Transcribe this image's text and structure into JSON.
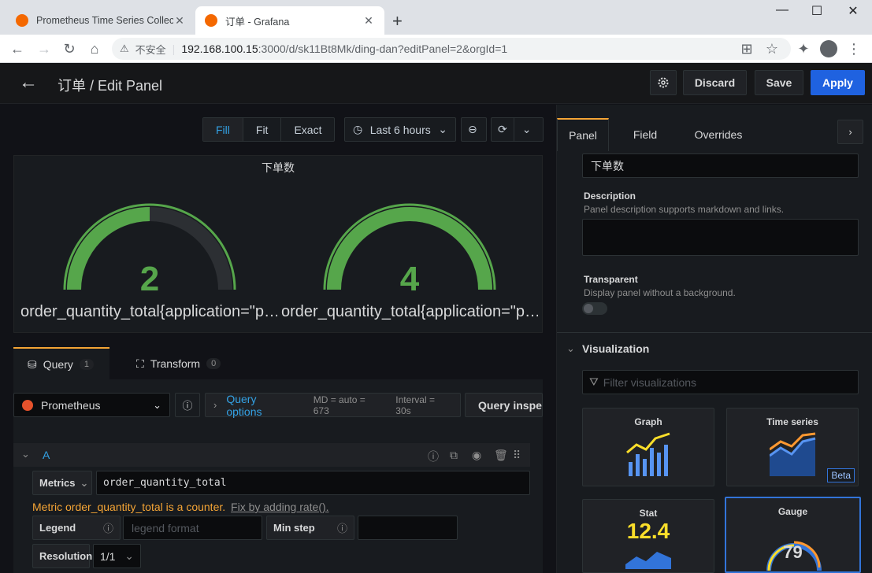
{
  "browser": {
    "tabs": [
      {
        "title": "Prometheus Time Series Collec",
        "active": false
      },
      {
        "title": "订单 - Grafana",
        "active": true
      }
    ],
    "new_tab": "+",
    "win_min": "—",
    "win_max": "☐",
    "win_close": "✕",
    "security_label": "不安全",
    "url_host": "192.168.100.15",
    "url_path": ":3000/d/sk11Bt8Mk/ding-dan?editPanel=2&orgId=1"
  },
  "header": {
    "back": "←",
    "title": "订单 / Edit Panel",
    "discard": "Discard",
    "save": "Save",
    "apply": "Apply"
  },
  "toolbar": {
    "fill": "Fill",
    "fit": "Fit",
    "exact": "Exact",
    "time_range": "Last 6 hours"
  },
  "panel": {
    "title": "下单数",
    "gauges": [
      {
        "value": "2",
        "fraction": 0.5,
        "label": "order_quantity_total{application=\"p…"
      },
      {
        "value": "4",
        "fraction": 1.0,
        "label": "order_quantity_total{application=\"p…"
      }
    ],
    "gauge_color": "#56a64b"
  },
  "query_tabs": [
    {
      "label": "Query",
      "count": "1"
    },
    {
      "label": "Transform",
      "count": "0"
    }
  ],
  "query": {
    "datasource": "Prometheus",
    "options_label": "Query options",
    "md": "MD = auto = 673",
    "interval": "Interval = 30s",
    "inspector": "Query inspector",
    "ref_id": "A",
    "metrics_label": "Metrics",
    "metrics_value": "order_quantity_total",
    "warning": "Metric order_quantity_total is a counter.",
    "warning_link": "Fix by adding rate().",
    "legend_label": "Legend",
    "legend_placeholder": "legend format",
    "min_step_label": "Min step",
    "resolution_label": "Resolution",
    "resolution_value": "1/1"
  },
  "side": {
    "tabs": [
      "Panel",
      "Field",
      "Overrides"
    ],
    "title_value": "下单数",
    "desc_label": "Description",
    "desc_sub": "Panel description supports markdown and links.",
    "transparent_label": "Transparent",
    "transparent_sub": "Display panel without a background.",
    "viz_header": "Visualization",
    "filter_placeholder": "Filter visualizations",
    "viz": [
      {
        "name": "Graph"
      },
      {
        "name": "Time series",
        "badge": "Beta"
      },
      {
        "name": "Stat",
        "value": "12.4"
      },
      {
        "name": "Gauge",
        "value": "79"
      }
    ]
  }
}
